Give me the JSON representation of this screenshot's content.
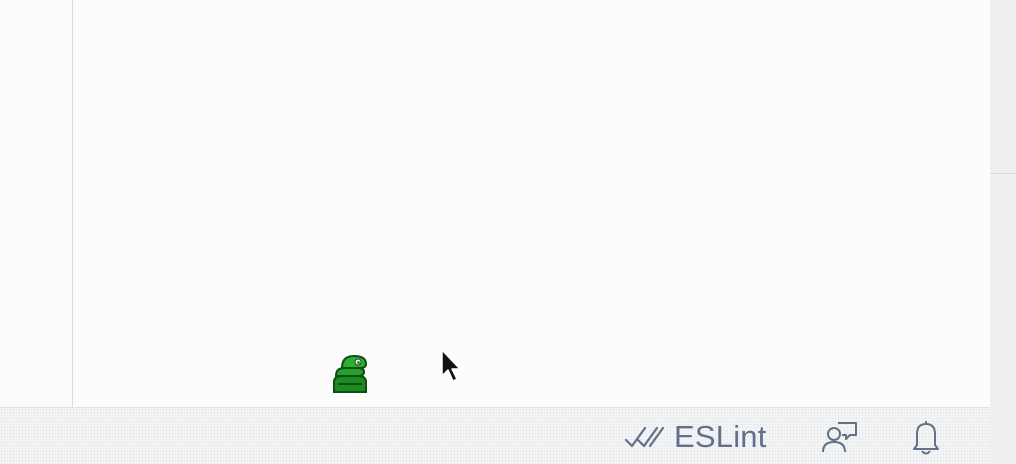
{
  "statusbar": {
    "eslint": {
      "icon": "double-check-icon",
      "label": "ESLint"
    },
    "feedback": {
      "icon": "person-feedback-icon"
    },
    "notifications": {
      "icon": "bell-icon"
    }
  },
  "overlay": {
    "mascot": "green-snake-icon",
    "cursor": "mouse-pointer-icon"
  },
  "colors": {
    "statusbar_text": "#62708a",
    "editor_background": "#fcfcfd"
  }
}
